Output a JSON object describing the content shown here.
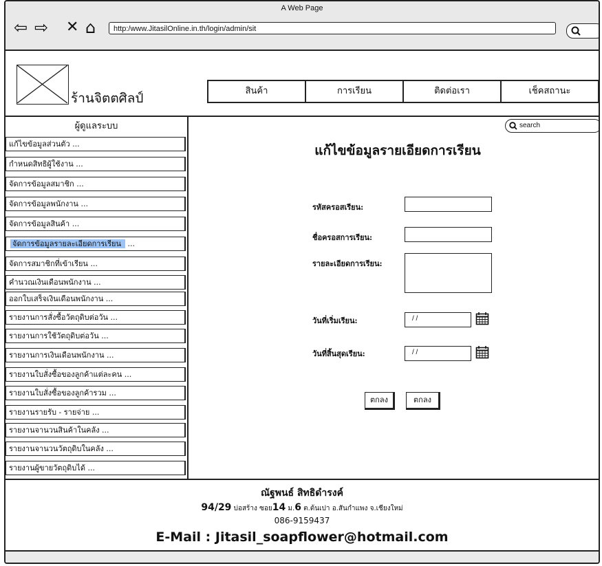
{
  "browser": {
    "window_title": "A Web Page",
    "url": "http:/www.JitasilOnline.in.th/login/admin/sit"
  },
  "header": {
    "shop_name": "ร้านจิตตศิลป์",
    "nav": [
      "สินค้า",
      "การเรียน",
      "ติดต่อเรา",
      "เช็คสถานะ"
    ]
  },
  "sidebar": {
    "title": "ผู้ดูแลระบบ",
    "items": [
      "แก้ไขข้อมูลส่วนตัว   ...",
      "กำหนดสิทธิผู้ใช้งาน   ...",
      "จัดการข้อมูลสมาชิก   ...",
      "จัดการข้อมูลพนักงาน   ...",
      "จัดการข้อมูลสินค้า   ...",
      "จัดการข้อมูลรายละเอียดการเรียน",
      "จัดการสมาชิกที่เข้าเรียน   ...",
      "คำนวณเงินเดือนพนักงาน   ...",
      "ออกใบเสร็จเงินเดือนพนักงาน   ...",
      "รายงานการสั่งซื้อวัตถุดิบต่อวัน   ...",
      "รายงานการใช้วัตถุดิบต่อวัน   ...",
      "รายงานการเงินเดือนพนักงาน   ...",
      "รายงานใบสั่งซื้อของลูกค้าแต่ละคน   ...",
      "รายงานใบสั่งซื้อของลูกค้ารวม   ...",
      "รายงานรายรับ - รายจ่าย   ...",
      "รายงานจานวนสินค้าในคลัง   ...",
      "รายงานจานวนวัตถุดิบในคลัง   ...",
      "รายงานผู้ขายวัตถุดิบได้   ..."
    ],
    "active_suffix": "..."
  },
  "search": {
    "placeholder": "search"
  },
  "form": {
    "title": "แก้ไขข้อมูลรายเอียดการเรียน",
    "labels": {
      "course_code": "รหัสครอสเรียน:",
      "course_name": "ชื่อครอสการเรียน:",
      "course_detail": "รายละเอียดการเรียน:",
      "start_date": "วันที่เริ่มเรียน:",
      "end_date": "วันที่สิ้นสุดเรียน:"
    },
    "date_placeholder": "/ /",
    "buttons": [
      "ตกลง",
      "ตกลง"
    ]
  },
  "footer": {
    "name": "ณัฐพนธ์ สิทธิดำรงค์",
    "addr_no": "94/29",
    "addr_mid1": " บ่อสร้าง ซอย",
    "soi": "14",
    "addr_mid2": "  ม.",
    "moo": "6",
    "addr_end": " ต.ต้นเปา อ.สันกำแพง จ.เชียงใหม่",
    "tel": "086-9159437",
    "email": "E-Mail : Jitasil_soapflower@hotmail.com"
  }
}
